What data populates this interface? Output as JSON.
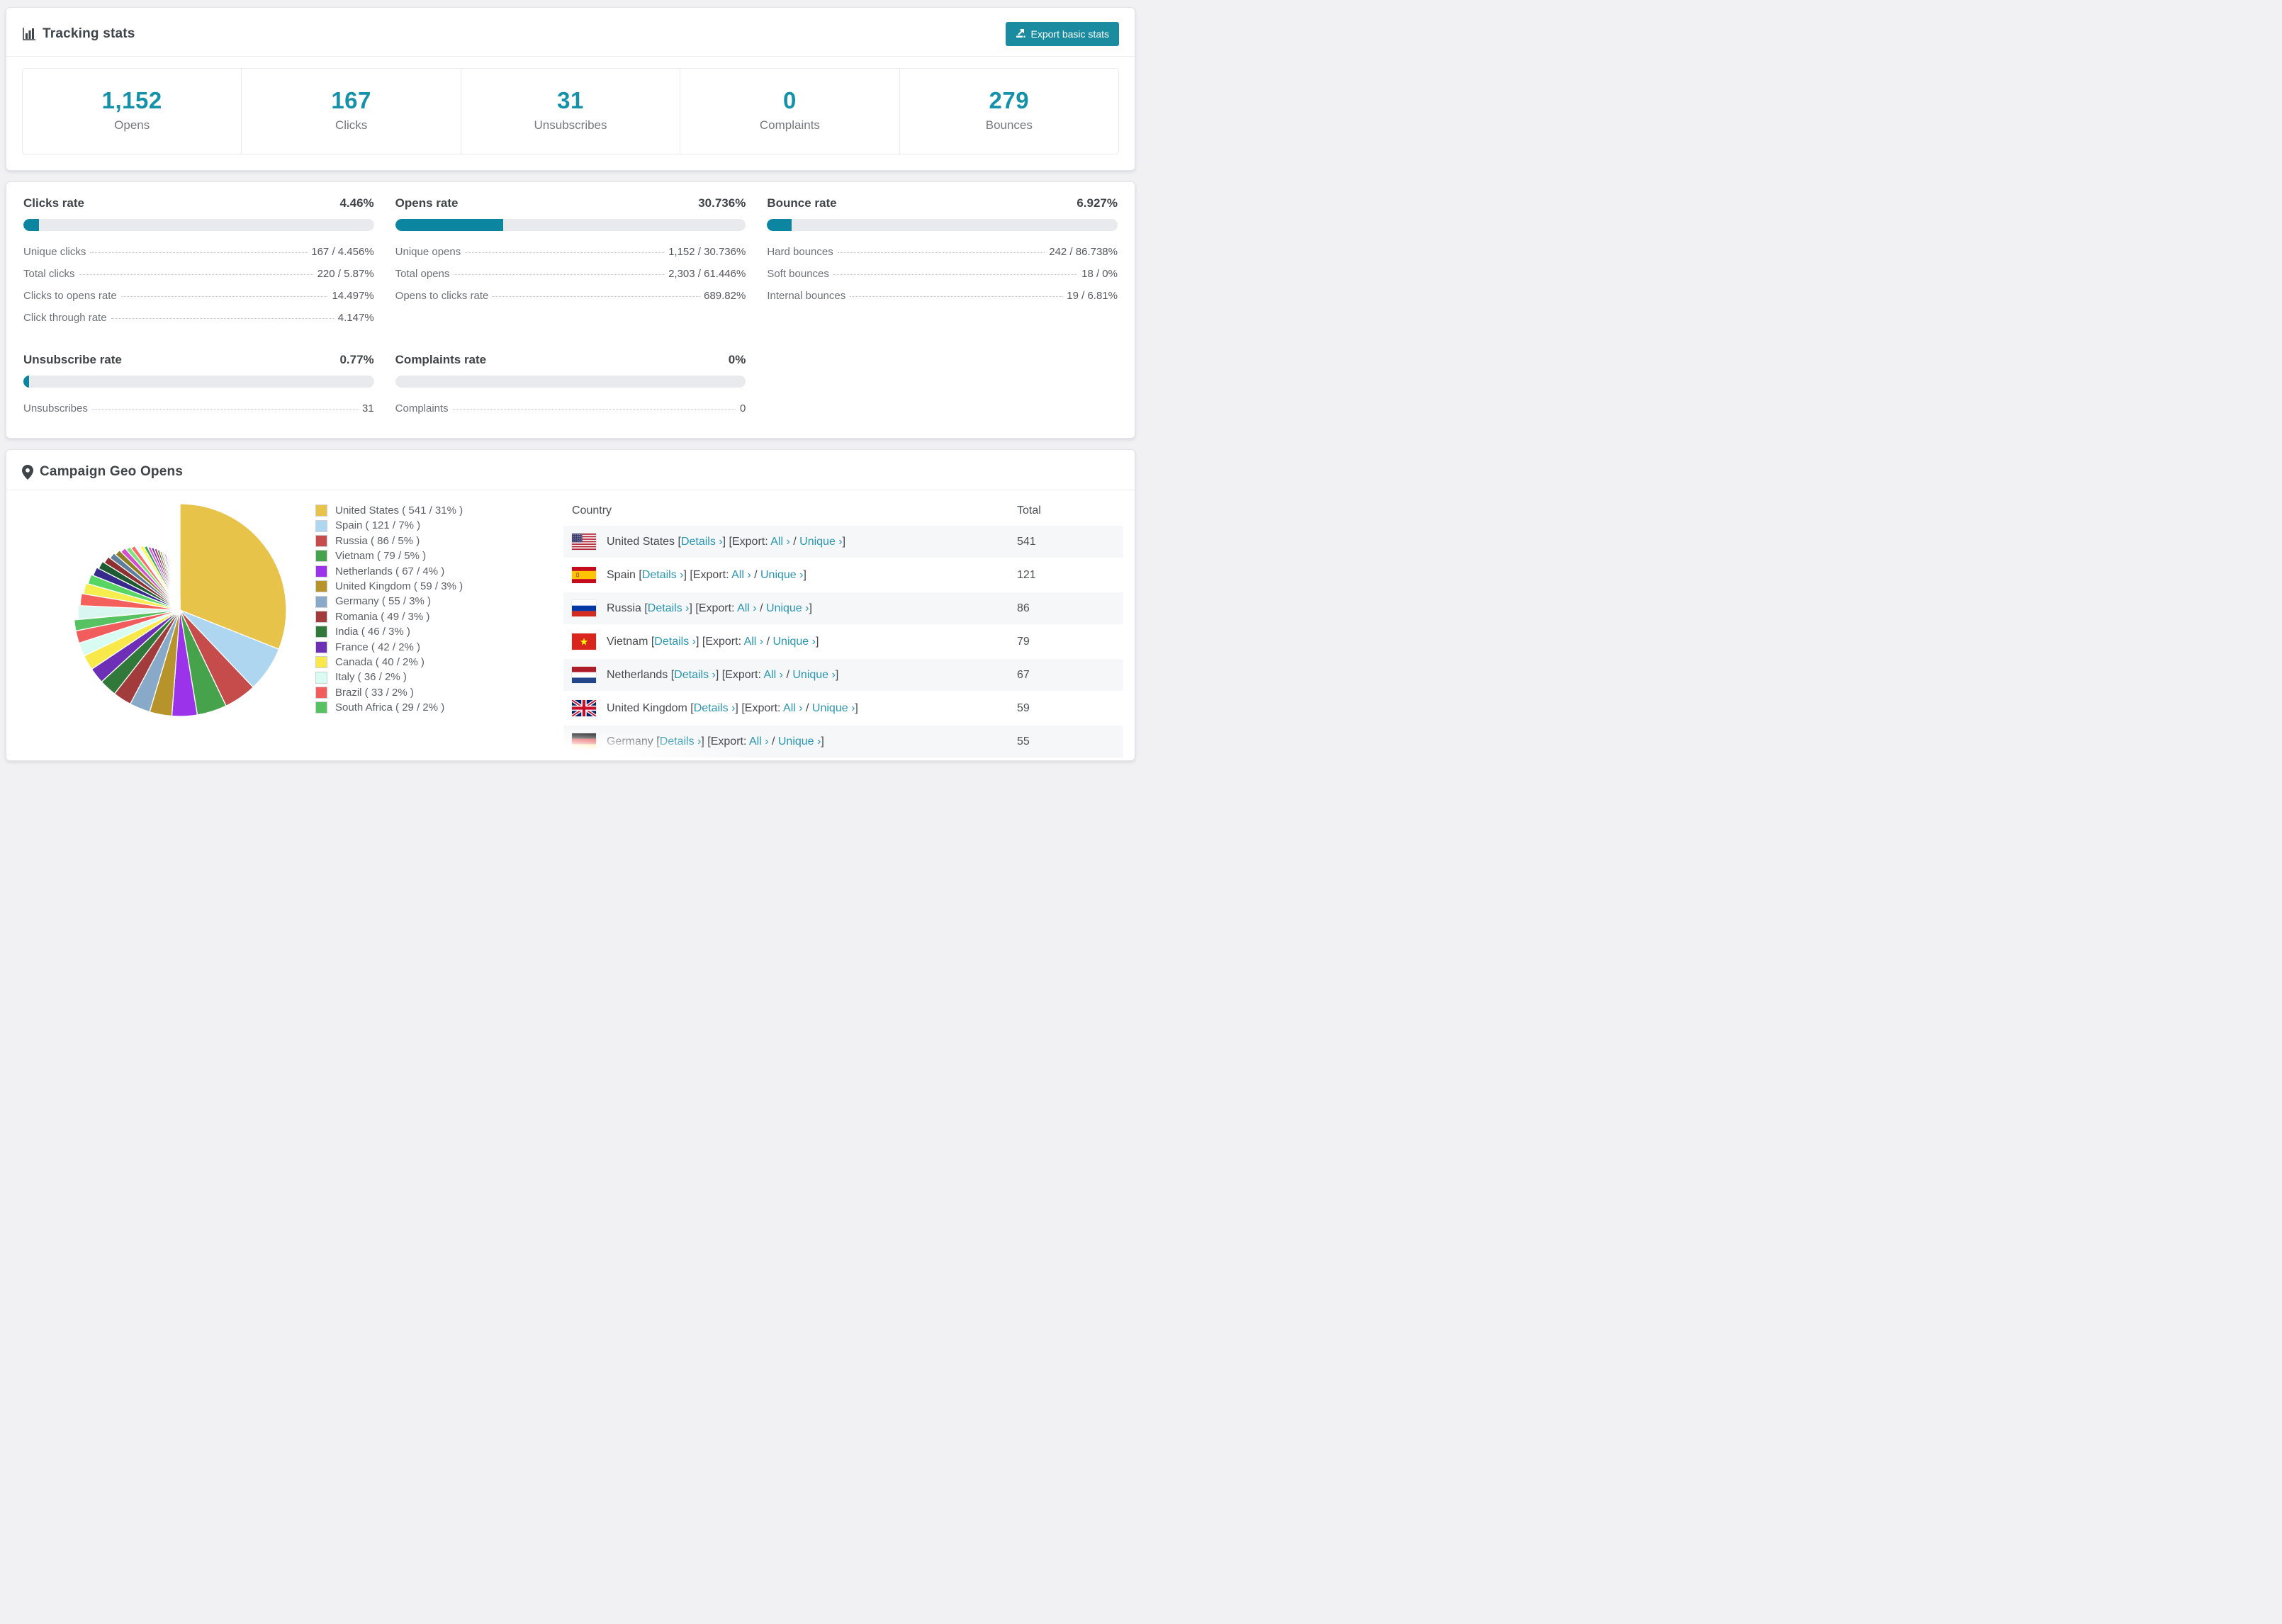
{
  "colors": {
    "page_bg": "#f1f1f4",
    "accent_teal": "#1b8ba0",
    "stat_number_teal": "#1691aa",
    "link_teal": "#2a96b0",
    "bar_fill": "#0c86a0",
    "bar_track": "#e9eaee"
  },
  "tracking_stats": {
    "title": "Tracking stats",
    "export_button_label": "Export basic stats",
    "summary": [
      {
        "value": "1,152",
        "label": "Opens"
      },
      {
        "value": "167",
        "label": "Clicks"
      },
      {
        "value": "31",
        "label": "Unsubscribes"
      },
      {
        "value": "0",
        "label": "Complaints"
      },
      {
        "value": "279",
        "label": "Bounces"
      }
    ]
  },
  "rates": [
    {
      "title": "Clicks rate",
      "value": "4.46%",
      "bar_pct": 4.46,
      "rows": [
        [
          "Unique clicks",
          "167 / 4.456%"
        ],
        [
          "Total clicks",
          "220 / 5.87%"
        ],
        [
          "Clicks to opens rate",
          "14.497%"
        ],
        [
          "Click through rate",
          "4.147%"
        ]
      ]
    },
    {
      "title": "Opens rate",
      "value": "30.736%",
      "bar_pct": 30.736,
      "rows": [
        [
          "Unique opens",
          "1,152 / 30.736%"
        ],
        [
          "Total opens",
          "2,303 / 61.446%"
        ],
        [
          "Opens to clicks rate",
          "689.82%"
        ]
      ]
    },
    {
      "title": "Bounce rate",
      "value": "6.927%",
      "bar_pct": 6.927,
      "rows": [
        [
          "Hard bounces",
          "242 / 86.738%"
        ],
        [
          "Soft bounces",
          "18 / 0%"
        ],
        [
          "Internal bounces",
          "19 / 6.81%"
        ]
      ]
    },
    {
      "title": "Unsubscribe rate",
      "value": "0.77%",
      "bar_pct": 0.77,
      "rows": [
        [
          "Unsubscribes",
          "31"
        ]
      ]
    },
    {
      "title": "Complaints rate",
      "value": "0%",
      "bar_pct": 0,
      "rows": [
        [
          "Complaints",
          "0"
        ]
      ]
    }
  ],
  "geo": {
    "title": "Campaign Geo Opens",
    "table_headers": [
      "Country",
      "Total"
    ],
    "links": {
      "details": "Details ›",
      "export_prefix": "Export:",
      "all": "All ›",
      "unique": "Unique ›"
    },
    "rows": [
      {
        "country": "United States",
        "flag": "us",
        "total": "541"
      },
      {
        "country": "Spain",
        "flag": "es",
        "total": "121"
      },
      {
        "country": "Russia",
        "flag": "ru",
        "total": "86"
      },
      {
        "country": "Vietnam",
        "flag": "vn",
        "total": "79"
      },
      {
        "country": "Netherlands",
        "flag": "nl",
        "total": "67"
      },
      {
        "country": "United Kingdom",
        "flag": "gb",
        "total": "59"
      },
      {
        "country": "Germany",
        "flag": "de",
        "total": "55"
      }
    ]
  },
  "chart_data": {
    "type": "pie",
    "title": "Campaign Geo Opens",
    "categories": [
      "United States",
      "Spain",
      "Russia",
      "Vietnam",
      "Netherlands",
      "United Kingdom",
      "Germany",
      "Romania",
      "India",
      "France",
      "Canada",
      "Italy",
      "Brazil",
      "South Africa"
    ],
    "values": [
      541,
      121,
      86,
      79,
      67,
      59,
      55,
      49,
      46,
      42,
      40,
      36,
      33,
      29
    ],
    "percents": [
      31,
      7,
      5,
      5,
      4,
      3,
      3,
      3,
      3,
      2,
      2,
      2,
      2,
      2
    ],
    "colors": [
      "#e8c34a",
      "#aed6f1",
      "#c64c4c",
      "#46a34c",
      "#9a33ea",
      "#b7932c",
      "#88aac8",
      "#a23c3c",
      "#30793a",
      "#6c2fb5",
      "#f9e84a",
      "#d9fcf2",
      "#f15c5c",
      "#57c262"
    ],
    "legend_position": "right",
    "start_angle_deg": -90,
    "direction": "clockwise",
    "estimated_unlabeled_slices": {
      "note": "~43 additional small unnamed country slices drawn with shrinking radius (spiral effect)",
      "values": [
        38,
        34,
        31,
        28,
        26,
        24,
        22,
        20,
        19,
        18,
        16,
        15,
        14,
        13,
        12,
        11,
        10,
        10,
        9,
        9,
        8,
        7,
        7,
        6,
        6,
        5,
        5,
        5,
        4,
        4,
        4,
        3,
        3,
        3,
        2,
        2,
        2,
        2,
        1,
        1,
        1,
        1,
        1
      ],
      "palette": [
        "#d9f7f0",
        "#f4615c",
        "#f6ee4f",
        "#57d663",
        "#372a8d",
        "#1d5c33",
        "#8f2f2f",
        "#5d7f9d",
        "#8f7f20",
        "#d24fd2",
        "#7be57b",
        "#fd6b66",
        "#eafaff",
        "#fdf94f",
        "#2fa84f",
        "#dd55dd",
        "#7033bb",
        "#bf3046",
        "#2e6f6f",
        "#caa53a",
        "#b9dcf5",
        "#a43ce0"
      ]
    }
  }
}
